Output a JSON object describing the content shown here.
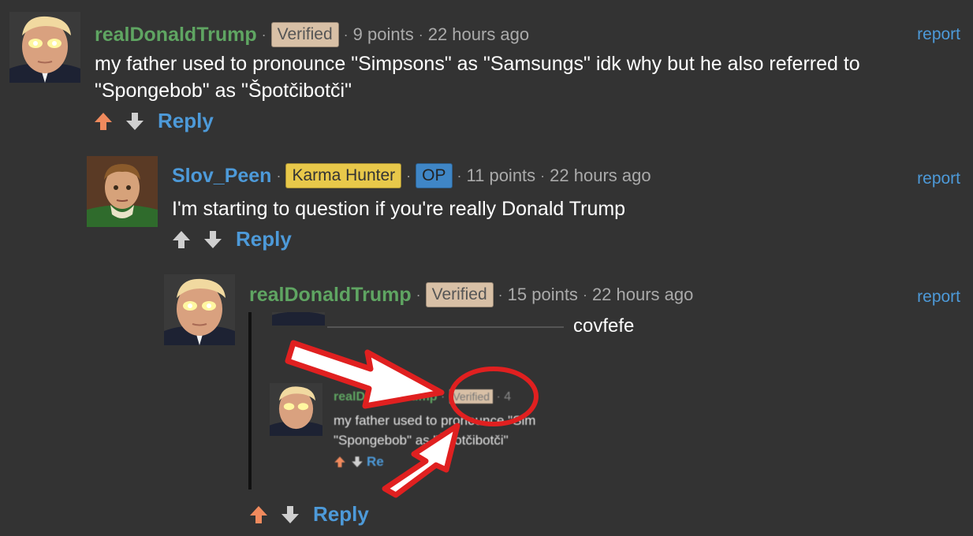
{
  "colors": {
    "background": "#333333",
    "green_author": "#5fa562",
    "blue_author": "#4d9ad9",
    "link": "#4d9ad9",
    "upvoted": "#f08a5d",
    "arrow_neutral": "#cfcfcf",
    "annotation_red": "#e02020"
  },
  "comments": [
    {
      "author": "realDonaldTrump",
      "badge": "Verified",
      "points": "9 points",
      "time": "22 hours ago",
      "report": "report",
      "body_line1": "my father used to pronounce \"Simpsons\" as \"Samsungs\" idk why but he also referred to",
      "body_line2": "\"Spongebob\" as \"Špotčibotči\"",
      "reply": "Reply",
      "upvoted": true
    },
    {
      "author": "Slov_Peen",
      "badge": "Karma Hunter",
      "badge2": "OP",
      "points": "11 points",
      "time": "22 hours ago",
      "report": "report",
      "body": "I'm starting to question if you're really Donald Trump",
      "reply": "Reply",
      "upvoted": false
    },
    {
      "author": "realDonaldTrump",
      "badge": "Verified",
      "points": "15 points",
      "time": "22 hours ago",
      "report": "report",
      "body": "covfefe",
      "reply": "Reply",
      "upvoted": true
    }
  ],
  "embedded_screenshot": {
    "author": "realDonaldTrump",
    "badge": "Verified",
    "points": "4",
    "line1": "my father used to pronounce \"Sim",
    "line2": "\"Spongebob\" as \"Špotčibotči\"",
    "reply": "Re"
  }
}
